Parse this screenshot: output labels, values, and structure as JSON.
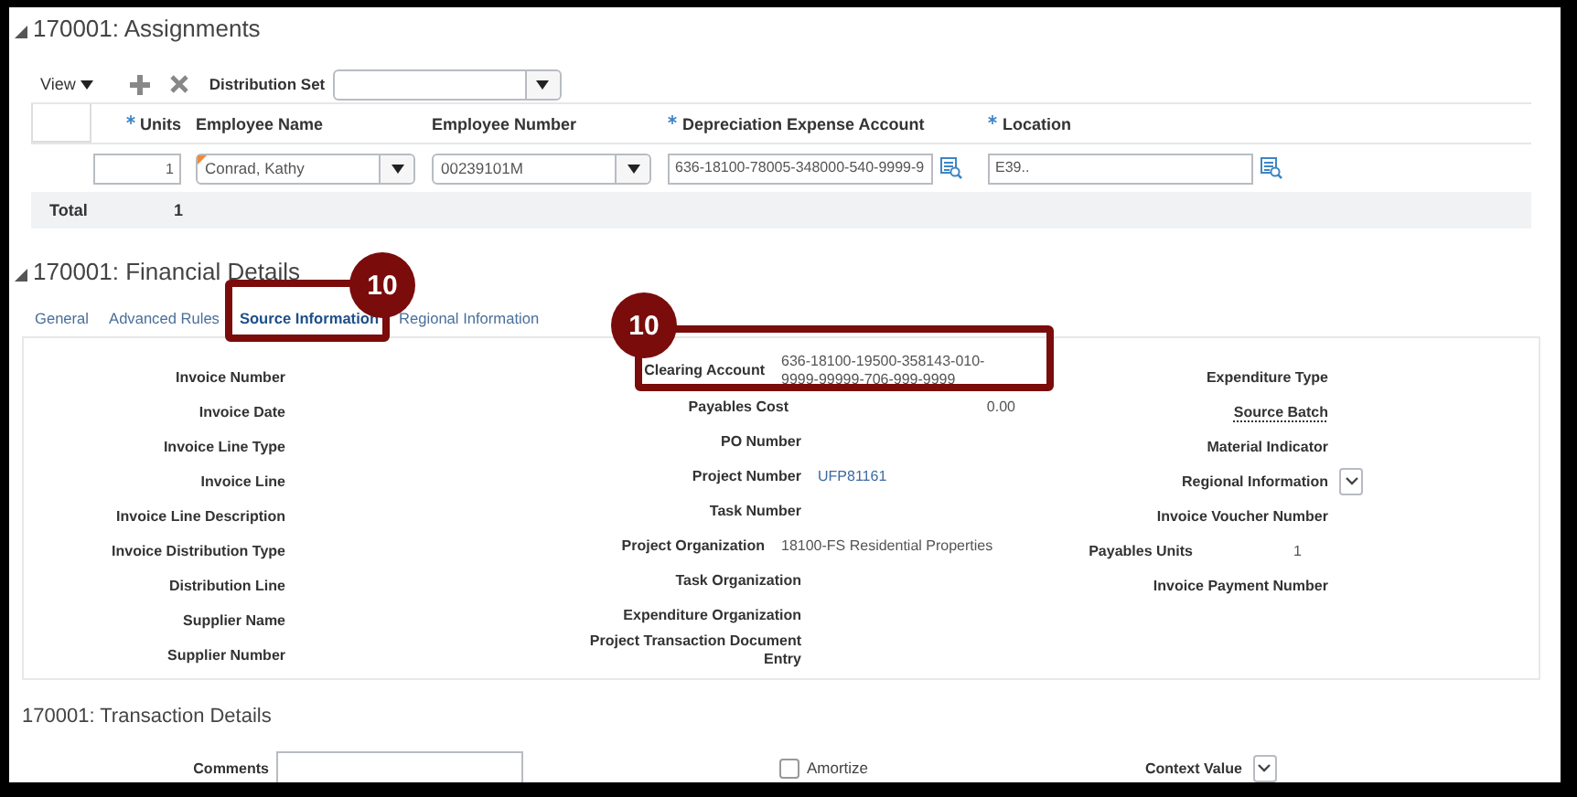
{
  "assignments": {
    "title": "170001: Assignments",
    "toolbar": {
      "view": "View",
      "distribution_set_label": "Distribution Set"
    },
    "columns": [
      {
        "label": "Units",
        "required": true
      },
      {
        "label": "Employee Name",
        "required": false
      },
      {
        "label": "Employee Number",
        "required": false
      },
      {
        "label": "Depreciation Expense Account",
        "required": true
      },
      {
        "label": "Location",
        "required": true
      }
    ],
    "rows": [
      {
        "units": "1",
        "employee_name": "Conrad, Kathy",
        "employee_number": "00239101M",
        "account": "636-18100-78005-348000-540-9999-9",
        "location": "E39.."
      }
    ],
    "total": {
      "label": "Total",
      "units": "1"
    }
  },
  "financial_details": {
    "title": "170001: Financial Details",
    "tabs": [
      {
        "label": "General",
        "selected": false
      },
      {
        "label": "Advanced Rules",
        "selected": false
      },
      {
        "label": "Source Information",
        "selected": true
      },
      {
        "label": "Regional Information",
        "selected": false
      }
    ],
    "columns": [
      [
        {
          "label": "Invoice Number",
          "kind": "text"
        },
        {
          "label": "Invoice Date",
          "kind": "text"
        },
        {
          "label": "Invoice Line Type",
          "kind": "text"
        },
        {
          "label": "Invoice Line",
          "kind": "text"
        },
        {
          "label": "Invoice Line Description",
          "kind": "text"
        },
        {
          "label": "Invoice Distribution Type",
          "kind": "text"
        },
        {
          "label": "Distribution Line",
          "kind": "text"
        },
        {
          "label": "Supplier Name",
          "kind": "text"
        },
        {
          "label": "Supplier Number",
          "kind": "text"
        }
      ],
      [
        {
          "label": "Clearing Account",
          "kind": "text",
          "value": "636-18100-19500-358143-010-9999-99999-706-999-9999"
        },
        {
          "label": "Payables Cost",
          "kind": "amount",
          "value": "0.00"
        },
        {
          "label": "PO Number",
          "kind": "text"
        },
        {
          "label": "Project Number",
          "kind": "link",
          "value": "UFP81161"
        },
        {
          "label": "Task Number",
          "kind": "text"
        },
        {
          "label": "Project Organization",
          "kind": "text",
          "value": "18100-FS Residential Properties"
        },
        {
          "label": "Task Organization",
          "kind": "text"
        },
        {
          "label": "Expenditure Organization",
          "kind": "text"
        },
        {
          "label": "Project Transaction Document Entry",
          "kind": "text"
        }
      ],
      [
        {
          "label": "Expenditure Type",
          "kind": "text"
        },
        {
          "label": "Source Batch",
          "kind": "help"
        },
        {
          "label": "Material Indicator",
          "kind": "text"
        },
        {
          "label": "Regional Information",
          "kind": "dropdown"
        },
        {
          "label": "Invoice Voucher Number",
          "kind": "text"
        },
        {
          "label": "Payables Units",
          "kind": "text",
          "value": "1"
        },
        {
          "label": "Invoice Payment Number",
          "kind": "text"
        }
      ]
    ]
  },
  "transaction_details": {
    "title": "170001: Transaction Details",
    "fields": [
      {
        "label": "Comments",
        "kind": "input"
      },
      {
        "label": "Amortize",
        "kind": "checkbox",
        "checked": false
      },
      {
        "label": "Context Value",
        "kind": "dropdown"
      }
    ]
  },
  "callouts": [
    {
      "number": "10"
    },
    {
      "number": "10"
    }
  ]
}
